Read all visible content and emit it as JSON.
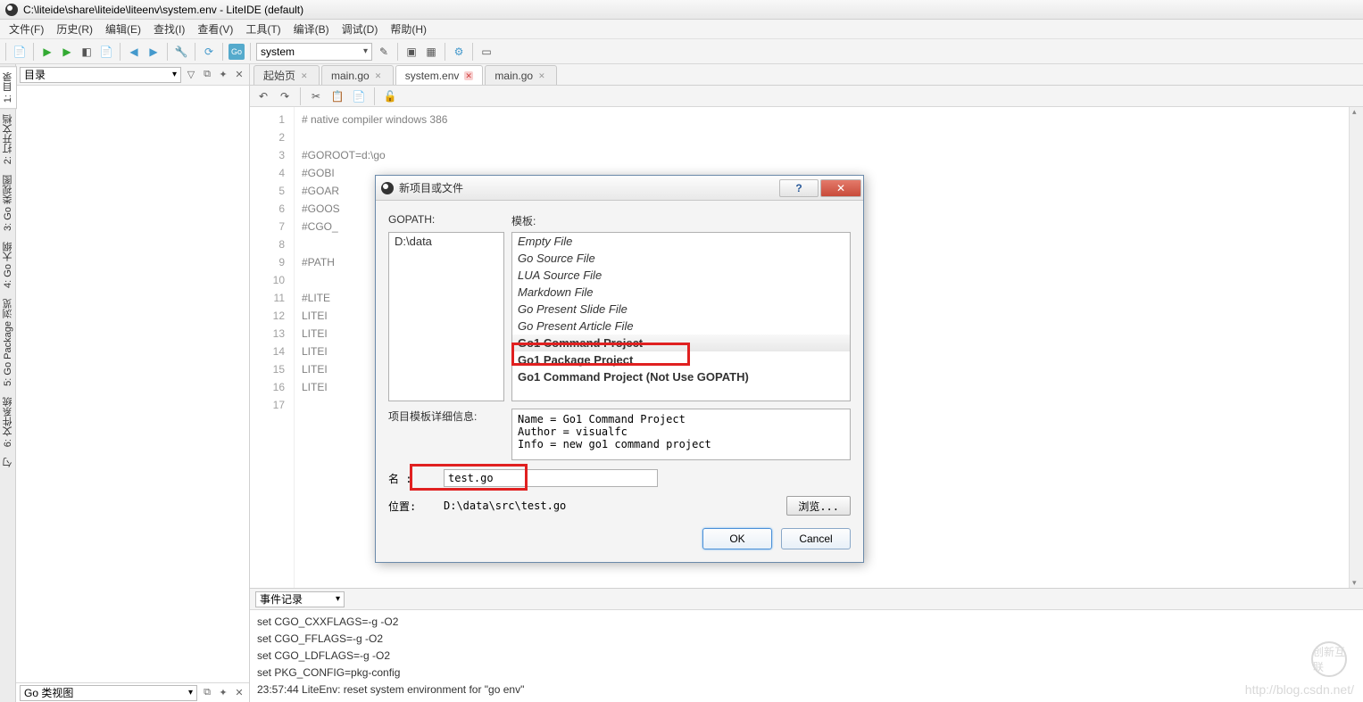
{
  "window": {
    "title": "C:\\liteide\\share\\liteide\\liteenv\\system.env - LiteIDE (default)"
  },
  "menu": {
    "file": "文件(F)",
    "history": "历史(R)",
    "edit": "编辑(E)",
    "find": "查找(I)",
    "view": "查看(V)",
    "tools": "工具(T)",
    "build": "编译(B)",
    "debug": "调试(D)",
    "help": "帮助(H)"
  },
  "toolbar": {
    "env": "system"
  },
  "sidebar": {
    "tabs": [
      "1: 目录",
      "2: 打开文档",
      "3: Go 类视图",
      "4: Go 大纲",
      "5: Go Package 浏览",
      "6: 文件系统"
    ],
    "startTab": "勺",
    "dir_label": "目录",
    "class_view_label": "Go 类视图"
  },
  "tabs": {
    "start": "起始页",
    "t1": "main.go",
    "t2": "system.env",
    "t3": "main.go"
  },
  "code": {
    "lines": [
      "# native compiler windows 386",
      "",
      "#GOROOT=d:\\go",
      "#GOBI",
      "#GOAR",
      "#GOOS",
      "#CGO_",
      "",
      "#PATH",
      "",
      "#LITE",
      "LITEI",
      "LITEI",
      "LITEI",
      "LITEI",
      "LITEI",
      ""
    ]
  },
  "bottom": {
    "header": "事件记录",
    "lines": [
      "set CGO_CXXFLAGS=-g -O2",
      "set CGO_FFLAGS=-g -O2",
      "set CGO_LDFLAGS=-g -O2",
      "set PKG_CONFIG=pkg-config",
      "23:57:44 LiteEnv: reset system environment for \"go env\""
    ]
  },
  "dialog": {
    "title": "新项目或文件",
    "gopath_label": "GOPATH:",
    "template_label": "模板:",
    "gopath_items": [
      "D:\\data"
    ],
    "templates": [
      "Empty File",
      "Go Source File",
      "LUA Source File",
      "Markdown File",
      "Go Present Slide File",
      "Go Present Article File",
      "Go1 Command Project",
      "Go1 Package Project",
      "Go1 Command Project (Not Use GOPATH)"
    ],
    "info_label": "项目模板详细信息:",
    "info_text": "Name = Go1 Command Project\nAuthor = visualfc\nInfo = new go1 command project",
    "name_label": "名 :",
    "name_value": "test.go",
    "loc_label": "位置:",
    "loc_value": "D:\\data\\src\\test.go",
    "browse": "浏览...",
    "ok": "OK",
    "cancel": "Cancel"
  },
  "watermark": {
    "url": "http://blog.csdn.net/",
    "logo": "创新互联"
  }
}
